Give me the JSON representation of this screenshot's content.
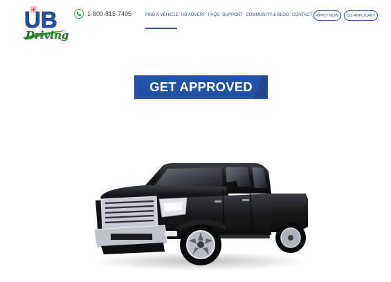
{
  "header": {
    "logo": {
      "top_text": "UB",
      "script_text": "Driving",
      "icon": "maple-leaf-icon"
    },
    "phone": {
      "icon": "phone-icon",
      "number": "1-800-815-7495"
    },
    "nav": [
      {
        "label": "Find a Vehicle"
      },
      {
        "label": "UB Advert"
      },
      {
        "label": "FAQs"
      },
      {
        "label": "Support"
      },
      {
        "label": "Community & Blog"
      },
      {
        "label": "Contact Us"
      }
    ],
    "apply_now": "Apply Now",
    "co_applicant": "Co-Applicant"
  },
  "hero": {
    "cta_label": "GET APPROVED",
    "image": "black-pickup-truck"
  },
  "colors": {
    "brand_blue": "#2351a6",
    "nav_text": "#3a4e8c",
    "phone_green": "#2e9e4a",
    "logo_green": "#3da33b",
    "logo_red": "#d62828"
  }
}
